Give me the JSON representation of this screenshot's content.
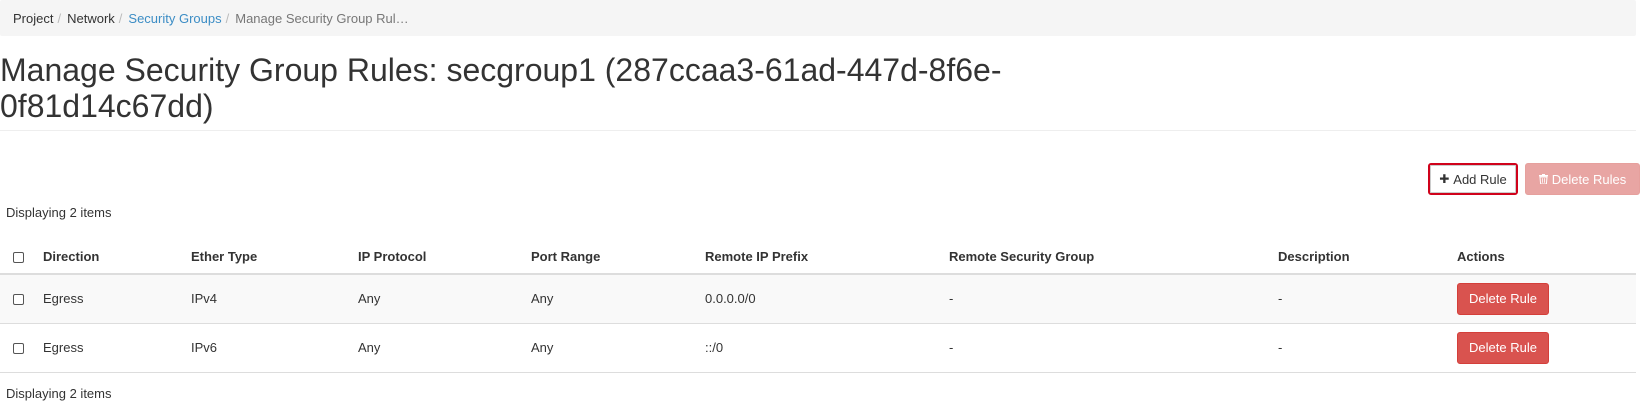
{
  "breadcrumb": [
    {
      "label": "Project",
      "kind": "plain"
    },
    {
      "label": "Network",
      "kind": "plain"
    },
    {
      "label": "Security Groups",
      "kind": "link"
    },
    {
      "label": "Manage Security Group Rul…",
      "kind": "active"
    }
  ],
  "breadcrumb_separator": "/",
  "page": {
    "title": "Manage Security Group Rules: secgroup1 (287ccaa3-61ad-447d-8f6e-0f81d14c67dd)"
  },
  "toolbar": {
    "add_rule_label": "Add Rule",
    "add_rule_icon": "plus-icon",
    "delete_rules_label": "Delete Rules",
    "delete_rules_icon": "trash-icon"
  },
  "table": {
    "count_top": "Displaying 2 items",
    "count_bottom": "Displaying 2 items",
    "columns": [
      "Direction",
      "Ether Type",
      "IP Protocol",
      "Port Range",
      "Remote IP Prefix",
      "Remote Security Group",
      "Description",
      "Actions"
    ],
    "rows": [
      {
        "direction": "Egress",
        "ether_type": "IPv4",
        "ip_protocol": "Any",
        "port_range": "Any",
        "remote_ip_prefix": "0.0.0.0/0",
        "remote_security_group": "-",
        "description": "-",
        "action_label": "Delete Rule"
      },
      {
        "direction": "Egress",
        "ether_type": "IPv6",
        "ip_protocol": "Any",
        "port_range": "Any",
        "remote_ip_prefix": "::/0",
        "remote_security_group": "-",
        "description": "-",
        "action_label": "Delete Rule"
      }
    ]
  },
  "colors": {
    "link": "#3c8dc5",
    "danger": "#d9534f",
    "danger_disabled": "#e8a5a3",
    "highlight": "#d0021b"
  }
}
